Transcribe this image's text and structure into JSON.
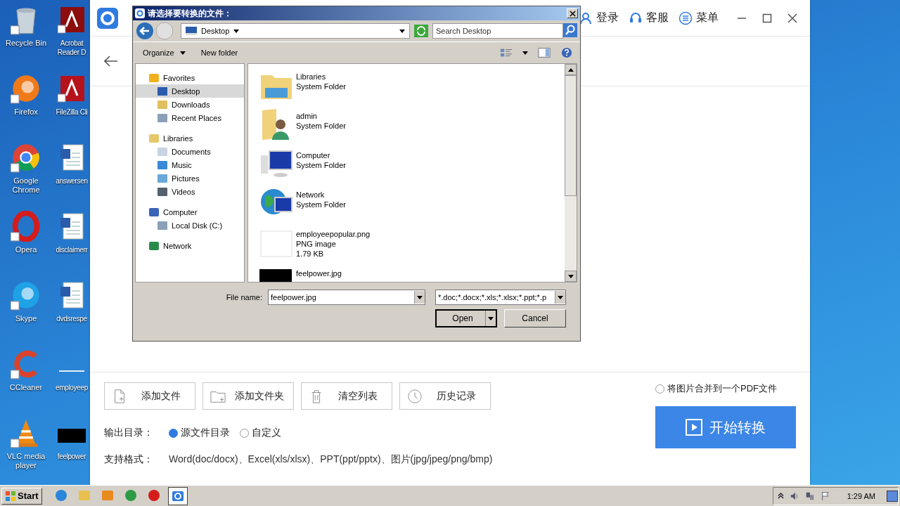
{
  "desktop": {
    "icons": [
      {
        "label": "Recycle Bin",
        "kind": "recycle"
      },
      {
        "label": "Acrobat Reader D",
        "kind": "acrobat"
      },
      {
        "label": "Firefox",
        "kind": "firefox"
      },
      {
        "label": "FileZilla Cli",
        "kind": "filezilla"
      },
      {
        "label": "Google Chrome",
        "kind": "chrome"
      },
      {
        "label": "answersen",
        "kind": "word"
      },
      {
        "label": "Opera",
        "kind": "opera"
      },
      {
        "label": "disclaimerr",
        "kind": "word"
      },
      {
        "label": "Skype",
        "kind": "skype"
      },
      {
        "label": "dvdsrespe",
        "kind": "word"
      },
      {
        "label": "CCleaner",
        "kind": "ccleaner"
      },
      {
        "label": "employeep",
        "kind": "blank"
      },
      {
        "label": "VLC media player",
        "kind": "vlc"
      },
      {
        "label": "feelpower",
        "kind": "black"
      }
    ]
  },
  "app": {
    "header_links": [
      {
        "label": "登录",
        "kind": "user"
      },
      {
        "label": "客服",
        "kind": "headset"
      },
      {
        "label": "菜单",
        "kind": "menu"
      }
    ],
    "toolbar": [
      {
        "label": "添加文件",
        "kind": "file"
      },
      {
        "label": "添加文件夹",
        "kind": "folder"
      },
      {
        "label": "清空列表",
        "kind": "trash"
      },
      {
        "label": "历史记录",
        "kind": "clock"
      }
    ],
    "merge_option": {
      "label": "将图片合并到一个PDF文件",
      "checked": false
    },
    "start_button": "开始转换",
    "output": {
      "label": "输出目录：",
      "options": [
        {
          "label": "源文件目录",
          "selected": true
        },
        {
          "label": "自定义",
          "selected": false
        }
      ]
    },
    "formats": {
      "label": "支持格式：",
      "value": "Word(doc/docx)、Excel(xls/xlsx)、PPT(ppt/pptx)、图片(jpg/jpeg/png/bmp)"
    }
  },
  "dialog": {
    "title": "请选择要转换的文件：",
    "location": "Desktop",
    "search": {
      "placeholder": "Search Desktop"
    },
    "toolbar": [
      "Organize",
      "New folder"
    ],
    "nav": [
      {
        "label": "Favorites",
        "kind": "star",
        "selected": false,
        "children": [
          {
            "label": "Desktop",
            "kind": "desktop",
            "selected": true
          },
          {
            "label": "Downloads",
            "kind": "download",
            "selected": false
          },
          {
            "label": "Recent Places",
            "kind": "recent",
            "selected": false
          }
        ]
      },
      {
        "label": "Libraries",
        "kind": "library",
        "selected": false,
        "children": [
          {
            "label": "Documents",
            "kind": "document",
            "selected": false
          },
          {
            "label": "Music",
            "kind": "music",
            "selected": false
          },
          {
            "label": "Pictures",
            "kind": "pictures",
            "selected": false
          },
          {
            "label": "Videos",
            "kind": "videos",
            "selected": false
          }
        ]
      },
      {
        "label": "Computer",
        "kind": "computer",
        "selected": false,
        "children": [
          {
            "label": "Local Disk (C:)",
            "kind": "disk",
            "selected": false
          }
        ]
      },
      {
        "label": "Network",
        "kind": "network",
        "selected": false
      }
    ],
    "files": [
      {
        "name": "Libraries",
        "type": "System Folder",
        "kind": "library"
      },
      {
        "name": "admin",
        "type": "System Folder",
        "kind": "user"
      },
      {
        "name": "Computer",
        "type": "System Folder",
        "kind": "computer"
      },
      {
        "name": "Network",
        "type": "System Folder",
        "kind": "network"
      },
      {
        "name": "employeepopular.png",
        "type": "PNG image",
        "size": "1.79 KB",
        "kind": "blank"
      },
      {
        "name": "feelpower.jpg",
        "kind": "black"
      }
    ],
    "file_name_label": "File name:",
    "file_name": "feelpower.jpg",
    "file_type": "*.doc;*.docx;*.xls;*.xlsx;*.ppt;*.p",
    "buttons": [
      "Open",
      "Cancel"
    ]
  },
  "taskbar": {
    "start": "Start",
    "apps": [
      {
        "kind": "ie",
        "selected": false
      },
      {
        "kind": "explorer",
        "selected": false
      },
      {
        "kind": "media",
        "selected": false
      },
      {
        "kind": "chrome",
        "selected": false
      },
      {
        "kind": "opera",
        "selected": false
      },
      {
        "kind": "app",
        "selected": true
      }
    ],
    "clock": "1:29 AM"
  }
}
